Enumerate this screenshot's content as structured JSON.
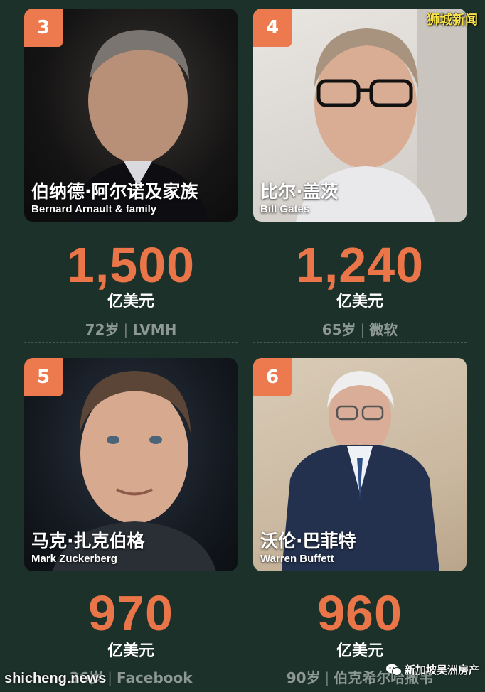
{
  "watermarks": {
    "top_right": "狮城新闻",
    "bottom_left": "shicheng.news",
    "bottom_right": "新加坡吴洲房产"
  },
  "people": [
    {
      "rank": "3",
      "name_cn": "伯纳德·阿尔诺及家族",
      "name_en": "Bernard Arnault & family",
      "worth": "1,500",
      "unit": "亿美元",
      "age": "72岁",
      "source": "LVMH"
    },
    {
      "rank": "4",
      "name_cn": "比尔·盖茨",
      "name_en": "Bill Gates",
      "worth": "1,240",
      "unit": "亿美元",
      "age": "65岁",
      "source": "微软"
    },
    {
      "rank": "5",
      "name_cn": "马克·扎克伯格",
      "name_en": "Mark Zuckerberg",
      "worth": "970",
      "unit": "亿美元",
      "age": "36岁",
      "source": "Facebook"
    },
    {
      "rank": "6",
      "name_cn": "沃伦·巴菲特",
      "name_en": "Warren Buffett",
      "worth": "960",
      "unit": "亿美元",
      "age": "90岁",
      "source": "伯克希尔哈撒韦"
    }
  ],
  "separator": "|",
  "icons": [
    "portrait-icon",
    "wechat-icon"
  ],
  "colors": {
    "accent": "#e97548",
    "background": "#1d312b"
  }
}
